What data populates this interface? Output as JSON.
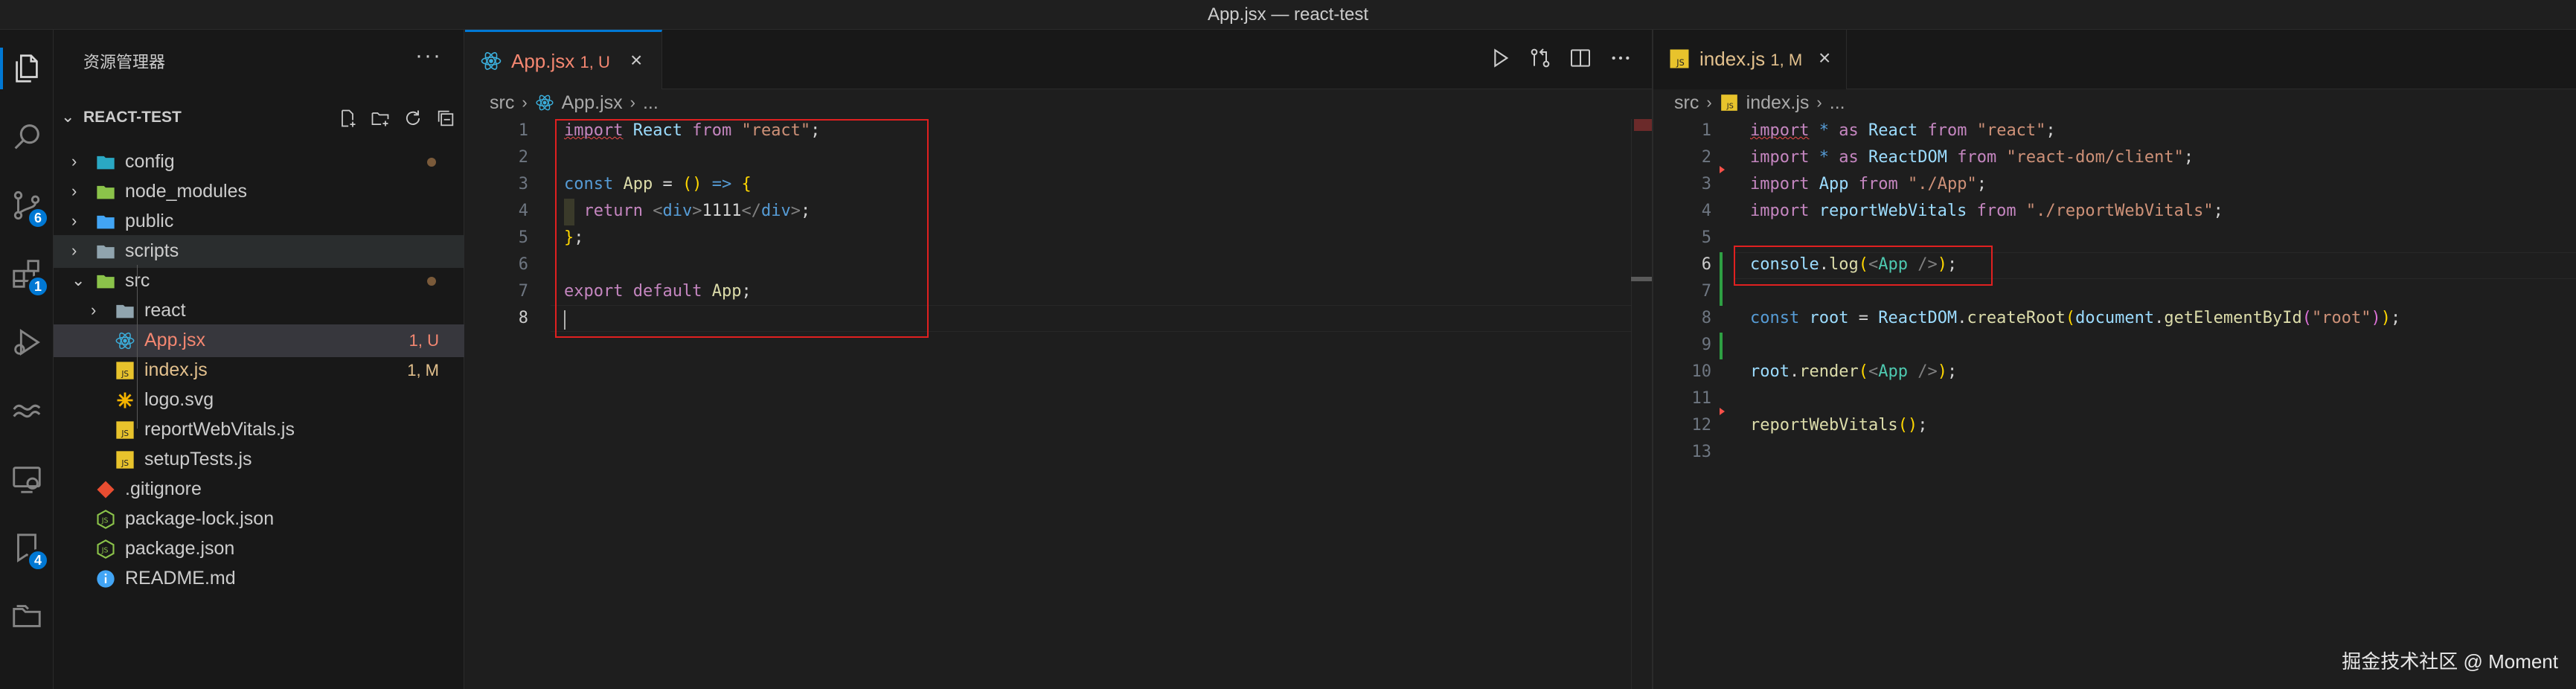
{
  "window": {
    "title": "App.jsx — react-test"
  },
  "activity": {
    "badges": {
      "scm": "6",
      "extensions": "1",
      "testing": "4"
    }
  },
  "explorer": {
    "header": "资源管理器",
    "more": "···",
    "section": "REACT-TEST",
    "items": [
      {
        "label": "config",
        "type": "folder",
        "depth": 0,
        "status": "",
        "dot": true
      },
      {
        "label": "node_modules",
        "type": "folder",
        "depth": 0,
        "status": "",
        "dot": false
      },
      {
        "label": "public",
        "type": "folder",
        "depth": 0,
        "status": "",
        "dot": false
      },
      {
        "label": "scripts",
        "type": "folder",
        "depth": 0,
        "status": "",
        "dot": false
      },
      {
        "label": "src",
        "type": "folder-open",
        "depth": 0,
        "status": "",
        "dot": true
      },
      {
        "label": "react",
        "type": "folder",
        "depth": 1,
        "status": "",
        "dot": false
      },
      {
        "label": "App.jsx",
        "type": "react",
        "depth": 1,
        "status": "1, U",
        "dot": false
      },
      {
        "label": "index.js",
        "type": "js",
        "depth": 1,
        "status": "1, M",
        "dot": false
      },
      {
        "label": "logo.svg",
        "type": "svg",
        "depth": 1,
        "status": "",
        "dot": false
      },
      {
        "label": "reportWebVitals.js",
        "type": "js",
        "depth": 1,
        "status": "",
        "dot": false
      },
      {
        "label": "setupTests.js",
        "type": "js",
        "depth": 1,
        "status": "",
        "dot": false
      },
      {
        "label": ".gitignore",
        "type": "git",
        "depth": 0,
        "status": "",
        "dot": false
      },
      {
        "label": "package-lock.json",
        "type": "json",
        "depth": 0,
        "status": "",
        "dot": false
      },
      {
        "label": "package.json",
        "type": "json",
        "depth": 0,
        "status": "",
        "dot": false
      },
      {
        "label": "README.md",
        "type": "info",
        "depth": 0,
        "status": "",
        "dot": false
      }
    ]
  },
  "left_editor": {
    "tab": {
      "label": "App.jsx",
      "status": "1, U",
      "close": "×"
    },
    "breadcrumb": {
      "folder": "src",
      "file": "App.jsx",
      "more": "..."
    },
    "line_numbers": [
      "1",
      "2",
      "3",
      "4",
      "5",
      "6",
      "7",
      "8"
    ],
    "lines": {
      "l1": {
        "import": "import",
        "name": "React",
        "from": "from",
        "src": "\"react\"",
        "end": ";"
      },
      "l3": {
        "const": "const",
        "name": "App",
        "eq": " = ",
        "paren": "()",
        "arrow": " => ",
        "brace": "{"
      },
      "l4": {
        "ret": "return",
        "open_lt": "<",
        "open_tag": "div",
        "open_gt": ">",
        "text": "1111",
        "close_lt": "</",
        "close_tag": "div",
        "close_gt": ">",
        "end": ";"
      },
      "l5": {
        "brace": "}",
        "end": ";"
      },
      "l7": {
        "export": "export",
        "default": "default",
        "name": "App",
        "end": ";"
      }
    }
  },
  "right_editor": {
    "tab": {
      "label": "index.js",
      "status": "1, M",
      "close": "×"
    },
    "breadcrumb": {
      "folder": "src",
      "file": "index.js",
      "more": "..."
    },
    "line_numbers": [
      "1",
      "2",
      "3",
      "4",
      "5",
      "6",
      "7",
      "8",
      "9",
      "10",
      "11",
      "12",
      "13"
    ],
    "lines": {
      "l1": {
        "import": "import",
        "star": " * ",
        "as": "as",
        "name": "React",
        "from": "from",
        "src": "\"react\"",
        "end": ";"
      },
      "l2": {
        "import": "import",
        "star": " * ",
        "as": "as",
        "name": "ReactDOM",
        "from": "from",
        "src": "\"react-dom/client\"",
        "end": ";"
      },
      "l3": {
        "import": "import",
        "name": "App",
        "from": "from",
        "src": "\"./App\"",
        "end": ";"
      },
      "l4": {
        "import": "import",
        "name": "reportWebVitals",
        "from": "from",
        "src": "\"./reportWebVitals\"",
        "end": ";"
      },
      "l6": {
        "obj": "console",
        "dot": ".",
        "fn": "log",
        "open": "(",
        "lt": "<",
        "tag": "App",
        "gt": " />",
        "close": ")",
        "end": ";"
      },
      "l8": {
        "const": "const",
        "name": "root",
        "eq": " = ",
        "obj": "ReactDOM",
        "dot": ".",
        "fn": "createRoot",
        "open": "(",
        "obj2": "document",
        "dot2": ".",
        "fn2": "getElementById",
        "open2": "(",
        "str": "\"root\"",
        "close2": ")",
        "close": ")",
        "end": ";"
      },
      "l10": {
        "obj": "root",
        "dot": ".",
        "fn": "render",
        "open": "(",
        "lt": "<",
        "tag": "App",
        "gt": " />",
        "close": ")",
        "end": ";"
      },
      "l12": {
        "fn": "reportWebVitals",
        "paren": "()",
        "end": ";"
      }
    }
  },
  "watermark": "掘金技术社区 @ Moment"
}
